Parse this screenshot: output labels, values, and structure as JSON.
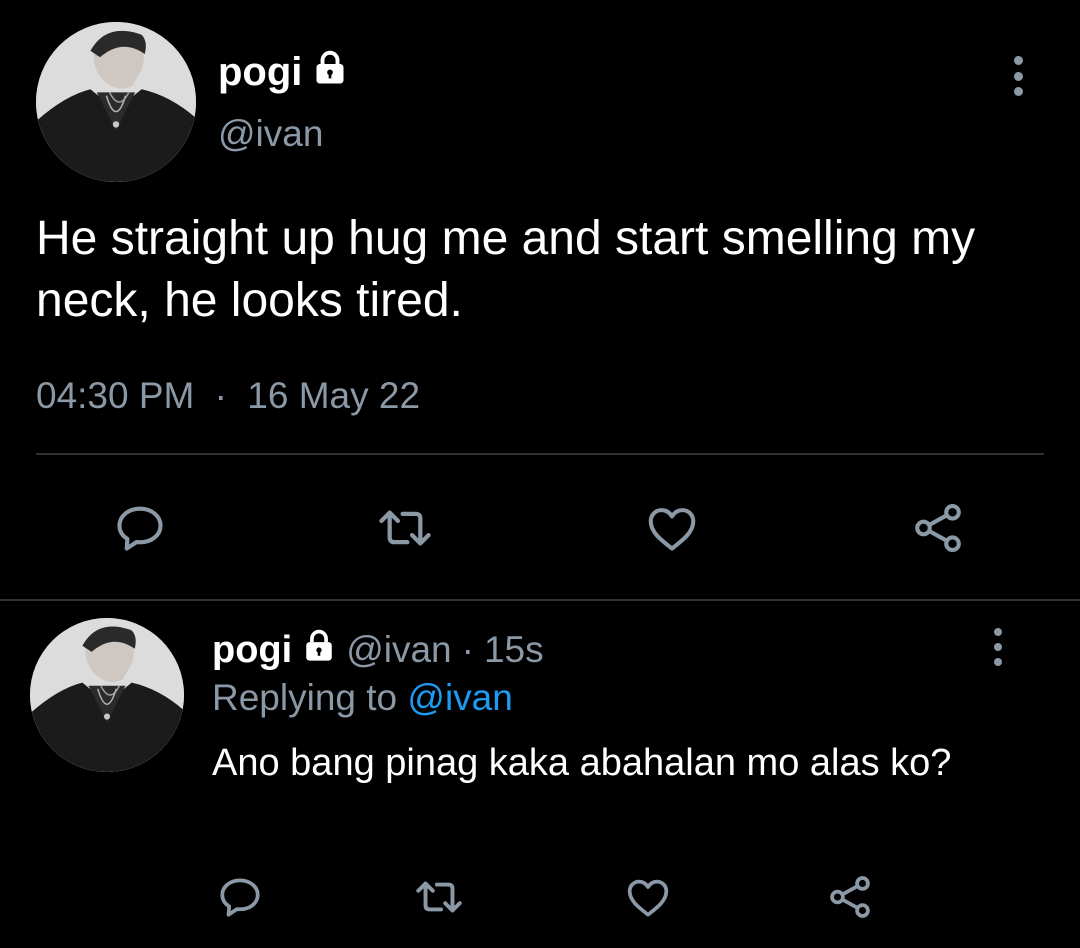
{
  "colors": {
    "background": "#000000",
    "text_primary": "#ffffff",
    "text_secondary": "#8b98a5",
    "link": "#1d9bf0",
    "divider": "#2f3336"
  },
  "main_tweet": {
    "display_name": "pogi",
    "handle": "@ivan",
    "text": "He straight up hug me and start smelling my neck, he looks tired.",
    "time": "04:30 PM",
    "separator": "·",
    "date": "16 May 22",
    "icons": {
      "verified_lock": "lock-icon",
      "more": "more-vertical-icon",
      "reply": "reply-icon",
      "retweet": "retweet-icon",
      "like": "heart-icon",
      "share": "share-icon"
    }
  },
  "reply_tweet": {
    "display_name": "pogi",
    "handle": "@ivan",
    "separator": "·",
    "time": "15s",
    "replying_prefix": "Replying to",
    "replying_handle": "@ivan",
    "text": "Ano bang pinag kaka abahalan mo alas ko?"
  }
}
